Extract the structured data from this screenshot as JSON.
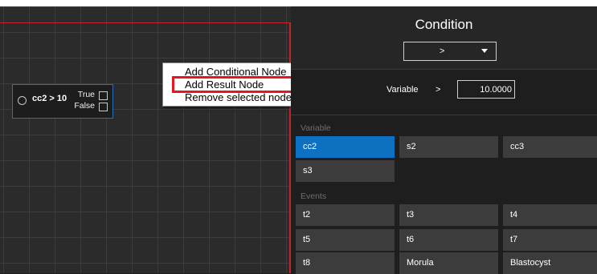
{
  "canvas": {
    "node": {
      "condition": "cc2 > 10",
      "true_label": "True",
      "false_label": "False"
    },
    "context_menu": {
      "items": [
        "Add Conditional Node",
        "Add Result Node",
        "Remove selected nodes"
      ],
      "highlighted": "Add Result Node"
    }
  },
  "panel": {
    "title": "Condition",
    "operator_select": {
      "value": ">"
    },
    "variable_row": {
      "label": "Variable",
      "operator": ">",
      "value": "10.0000"
    },
    "variables": {
      "header": "Variable",
      "items": [
        "cc2",
        "s2",
        "cc3",
        "s3"
      ],
      "selected": "cc2"
    },
    "events": {
      "header": "Events",
      "items": [
        "t2",
        "t3",
        "t4",
        "t5",
        "t6",
        "t7",
        "t8",
        "Morula",
        "Blastocyst"
      ]
    }
  },
  "colors": {
    "selected_tile": "#0e70c0",
    "highlight_box": "#e8151f",
    "canvas_border": "#c2262a",
    "node_border": "#2c6fb5"
  }
}
